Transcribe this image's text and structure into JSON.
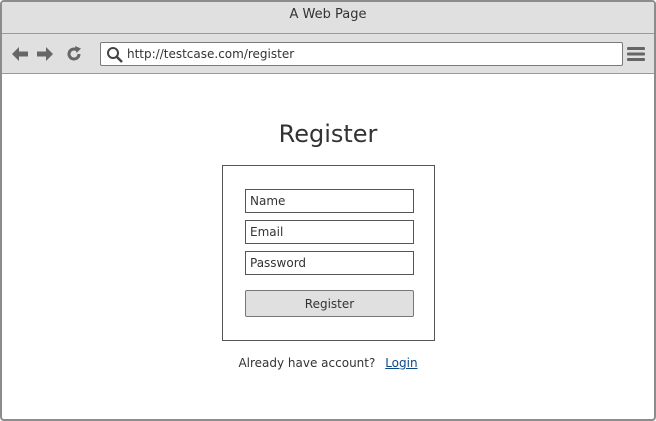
{
  "window": {
    "title": "A Web Page"
  },
  "toolbar": {
    "back_icon": "arrow-left-icon",
    "forward_icon": "arrow-right-icon",
    "reload_icon": "reload-icon",
    "menu_icon": "hamburger-menu-icon",
    "address": {
      "value": "http://testcase.com/register",
      "icon": "search-icon"
    }
  },
  "page": {
    "title": "Register",
    "form": {
      "name_placeholder": "Name",
      "email_placeholder": "Email",
      "password_placeholder": "Password",
      "submit_label": "Register"
    },
    "footer": {
      "prompt": "Already have account?",
      "login_link": "Login"
    }
  },
  "colors": {
    "chrome_bg": "#e0e0e0",
    "border": "#8c8c8c",
    "link": "#0b4a8a",
    "button_bg": "#e0e0e0"
  }
}
